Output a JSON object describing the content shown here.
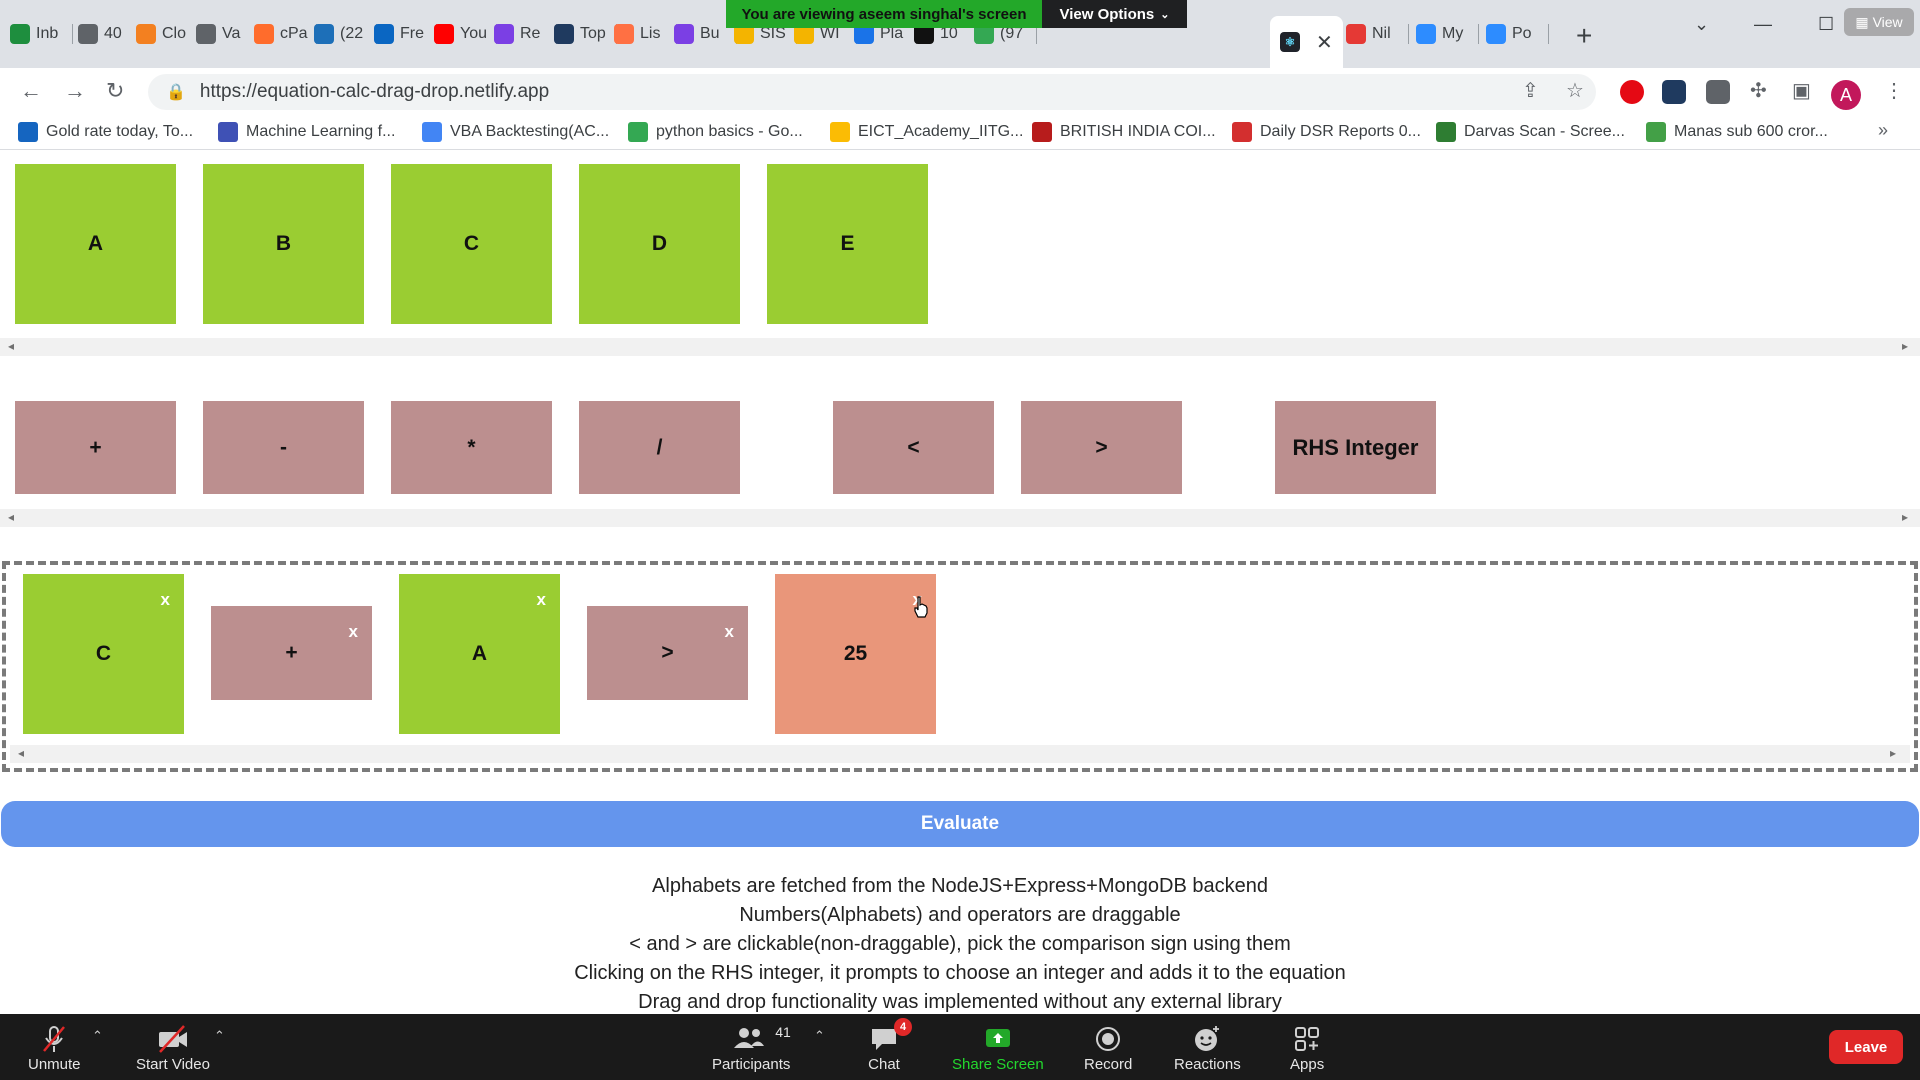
{
  "browser": {
    "tabs": [
      {
        "label": "Inb",
        "color": "#1e8e3e"
      },
      {
        "label": "40",
        "color": "#5f6368"
      },
      {
        "label": "Clo",
        "color": "#f38020"
      },
      {
        "label": "Va",
        "color": "#5f6368"
      },
      {
        "label": "cPa",
        "color": "#ff6c2c"
      },
      {
        "label": "(22",
        "color": "#1d6fb8"
      },
      {
        "label": "Fre",
        "color": "#0a66c2"
      },
      {
        "label": "You",
        "color": "#ff0000"
      },
      {
        "label": "Re",
        "color": "#7b3fe4"
      },
      {
        "label": "Top",
        "color": "#1f3a5f"
      },
      {
        "label": "Lis",
        "color": "#ff7043"
      },
      {
        "label": "Bu",
        "color": "#7b3fe4"
      },
      {
        "label": "SIS",
        "color": "#f4b400"
      },
      {
        "label": "WI",
        "color": "#f4b400"
      },
      {
        "label": "Pla",
        "color": "#1a73e8"
      },
      {
        "label": "10",
        "color": "#111111"
      },
      {
        "label": "(97",
        "color": "#34a853"
      },
      {
        "label": "Nil",
        "color": "#e53935"
      },
      {
        "label": "My",
        "color": "#2d8cff"
      },
      {
        "label": "Po",
        "color": "#2d8cff"
      }
    ],
    "share_banner": "You are viewing aseem singhal's screen",
    "view_options": "View Options",
    "view_pill": "View",
    "url": "https://equation-calc-drag-drop.netlify.app",
    "avatar_letter": "A",
    "bookmarks": [
      {
        "label": "Gold rate today, To...",
        "color": "#1565c0"
      },
      {
        "label": "Machine Learning f...",
        "color": "#3f51b5"
      },
      {
        "label": "VBA Backtesting(AC...",
        "color": "#4285f4"
      },
      {
        "label": "python basics - Go...",
        "color": "#34a853"
      },
      {
        "label": "EICT_Academy_IITG...",
        "color": "#fbbc04"
      },
      {
        "label": "BRITISH INDIA COI...",
        "color": "#b71c1c"
      },
      {
        "label": "Daily DSR Reports 0...",
        "color": "#d32f2f"
      },
      {
        "label": "Darvas Scan - Scree...",
        "color": "#2e7d32"
      },
      {
        "label": "Manas sub 600 cror...",
        "color": "#43a047"
      }
    ]
  },
  "alphabets": [
    "A",
    "B",
    "C",
    "D",
    "E"
  ],
  "operators": [
    "+",
    "-",
    "*",
    "/"
  ],
  "comparators": [
    "<",
    ">"
  ],
  "rhs_button": "RHS Integer",
  "equation": [
    {
      "label": "C",
      "kind": "alphabet",
      "remove": "x"
    },
    {
      "label": "+",
      "kind": "operator",
      "remove": "x"
    },
    {
      "label": "A",
      "kind": "alphabet",
      "remove": "x"
    },
    {
      "label": ">",
      "kind": "operator",
      "remove": "x"
    },
    {
      "label": "25",
      "kind": "rhs",
      "remove": "x"
    }
  ],
  "evaluate_label": "Evaluate",
  "notes": [
    "Alphabets are fetched from the NodeJS+Express+MongoDB backend",
    "Numbers(Alphabets) and operators are draggable",
    "< and > are clickable(non-draggable), pick the comparison sign using them",
    "Clicking on the RHS integer, it prompts to choose an integer and adds it to the equation",
    "Drag and drop functionality was implemented without any external library"
  ],
  "zoom": {
    "unmute": "Unmute",
    "start_video": "Start Video",
    "participants": "Participants",
    "participants_count": "41",
    "chat": "Chat",
    "chat_badge": "4",
    "share_screen": "Share Screen",
    "record": "Record",
    "reactions": "Reactions",
    "apps": "Apps",
    "leave": "Leave"
  }
}
